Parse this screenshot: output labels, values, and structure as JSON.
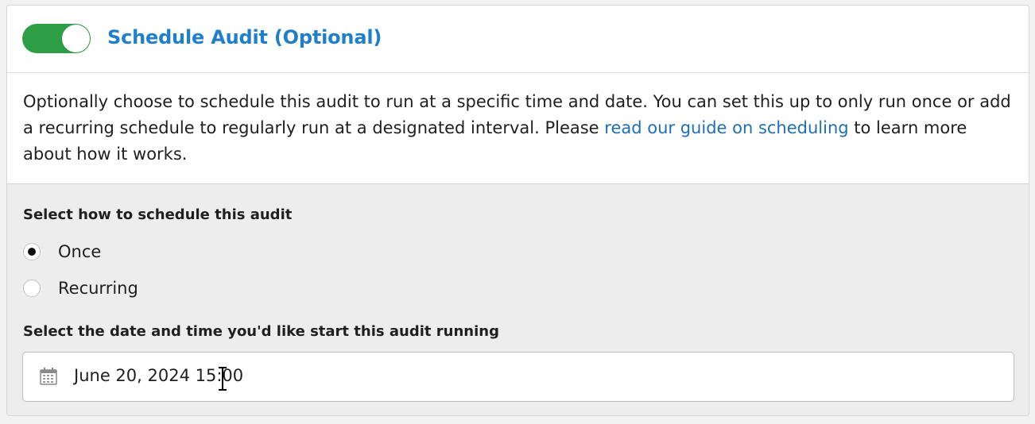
{
  "header": {
    "title": "Schedule Audit (Optional)",
    "toggle_on": true,
    "toggle_color": "#2e9e46"
  },
  "description": {
    "before_link": "Optionally choose to schedule this audit to run at a specific time and date. You can set this up to only run once or add a recurring schedule to regularly run at a designated interval. Please ",
    "link_text": "read our guide on scheduling",
    "after_link": " to learn more about how it works."
  },
  "schedule": {
    "label": "Select how to schedule this audit",
    "options": [
      {
        "label": "Once",
        "selected": true
      },
      {
        "label": "Recurring",
        "selected": false
      }
    ]
  },
  "start": {
    "label": "Select the date and time you'd like start this audit running",
    "value": "June 20, 2024 15:00",
    "icon": "calendar-icon"
  },
  "colors": {
    "title": "#1f7fc9",
    "link": "#1f6fb2",
    "panel_bg": "#ededed"
  }
}
